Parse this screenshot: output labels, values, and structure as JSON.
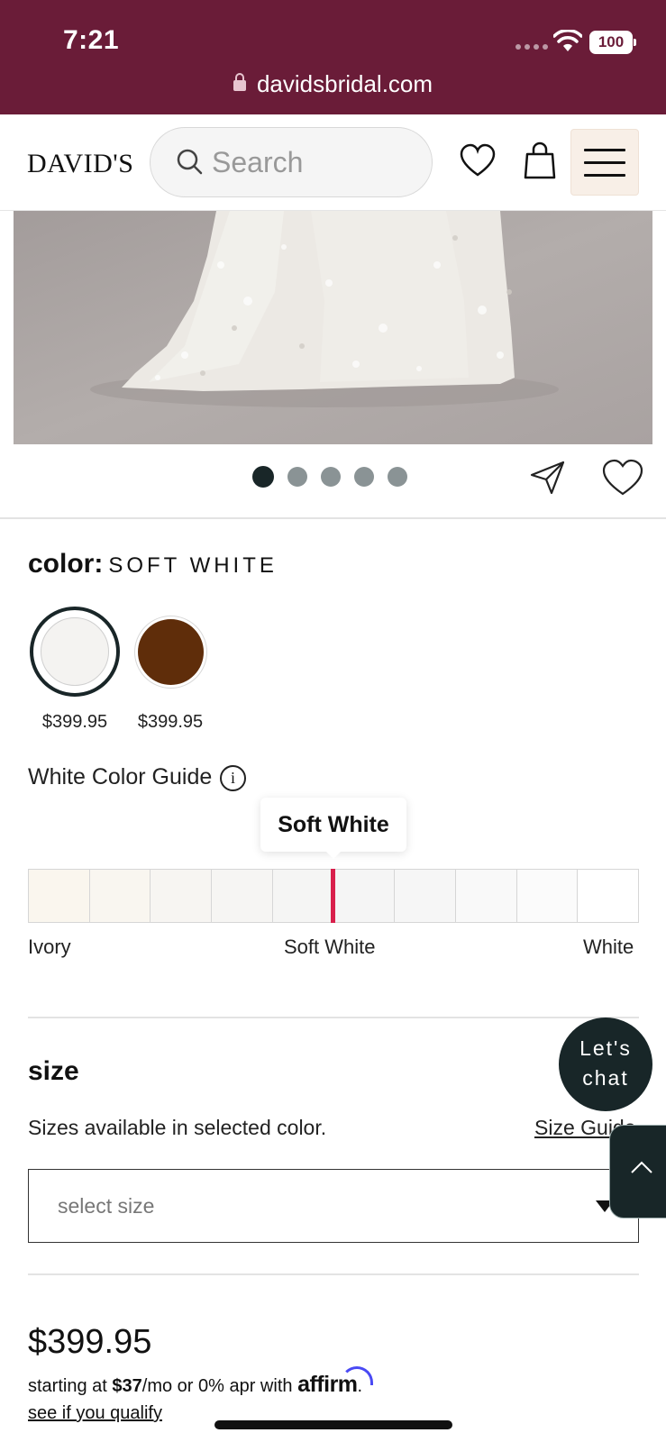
{
  "status_bar": {
    "time": "7:21",
    "battery": "100",
    "url": "davidsbridal.com"
  },
  "header": {
    "logo": "DAVID'S",
    "search_placeholder": "Search"
  },
  "color": {
    "label": "color:",
    "selected": "SOFT WHITE",
    "swatches": [
      {
        "name": "soft-white",
        "hex": "#f4f3f1",
        "price": "$399.95"
      },
      {
        "name": "brown",
        "hex": "#5f2d0a",
        "price": "$399.95"
      }
    ]
  },
  "guide": {
    "title": "White Color Guide",
    "tooltip": "Soft White",
    "scale_colors": [
      "#faf6ee",
      "#f9f6f0",
      "#f7f5f2",
      "#f6f5f3",
      "#f5f5f4",
      "#f5f5f5",
      "#f6f6f6",
      "#f9f9f9",
      "#fbfbfb",
      "#ffffff"
    ],
    "marker_position": 0.5,
    "labels": {
      "left": "Ivory",
      "middle": "Soft White",
      "right": "White"
    }
  },
  "size": {
    "title": "size",
    "note": "Sizes available in selected color.",
    "guide_link": "Size Guide",
    "select_placeholder": "select size"
  },
  "chat": {
    "line1": "Let's",
    "line2": "chat"
  },
  "pricing": {
    "price": "$399.95",
    "affirm_prefix": "starting at ",
    "affirm_amount": "$37",
    "affirm_suffix": "/mo or 0% apr with ",
    "affirm_brand": "affirm",
    "qualify_link": "see if you qualify"
  },
  "carousel": {
    "count": 5,
    "active": 1
  }
}
